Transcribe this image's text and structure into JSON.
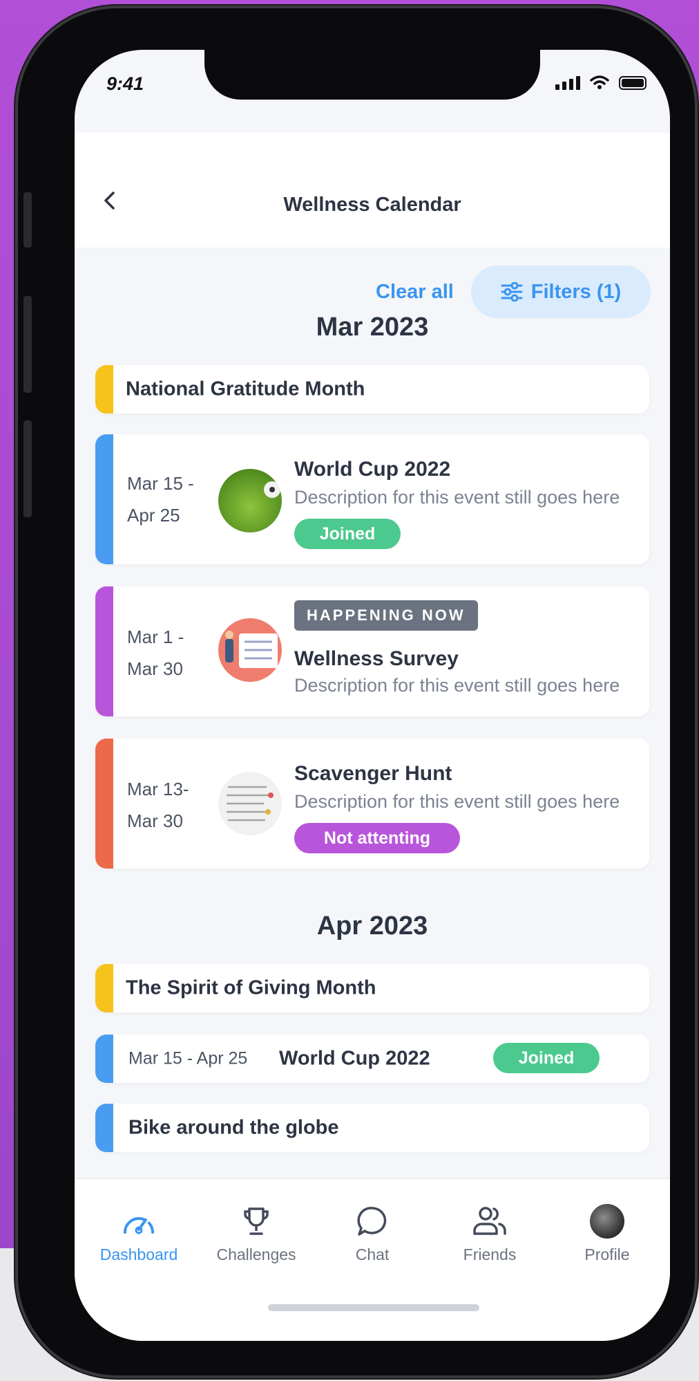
{
  "status": {
    "time": "9:41"
  },
  "header": {
    "title": "Wellness Calendar"
  },
  "filters": {
    "clear_label": "Clear all",
    "filters_label": "Filters (1)"
  },
  "months": [
    {
      "label": "Mar 2023",
      "observance": {
        "label": "National Gratitude Month",
        "color": "#f6c21c"
      },
      "events": [
        {
          "date_start": "Mar 15 -",
          "date_end": "Apr 25",
          "title": "World Cup 2022",
          "description": "Description for this event still goes here",
          "status": "Joined",
          "color": "#4a9cf2"
        },
        {
          "date_start": "Mar 1 -",
          "date_end": "Mar 30",
          "title": "Wellness Survey",
          "description": "Description for this event still goes here",
          "badge": "HAPPENING NOW",
          "color": "#b856db"
        },
        {
          "date_start": "Mar 13-",
          "date_end": "Mar 30",
          "title": "Scavenger Hunt",
          "description": "Description for this event still goes here",
          "status": "Not attenting",
          "color": "#ec6a4a"
        }
      ]
    },
    {
      "label": "Apr 2023",
      "observance": {
        "label": "The Spirit of Giving Month",
        "color": "#f6c21c"
      },
      "compact_events": [
        {
          "date": "Mar 15 - Apr 25",
          "title": "World Cup 2022",
          "status": "Joined",
          "color": "#4a9cf2"
        },
        {
          "title": "Bike around the globe",
          "color": "#4a9cf2"
        }
      ]
    }
  ],
  "colors": {
    "accent": "#3a94f0",
    "joined": "#4cc98e",
    "not_attending": "#b856db"
  },
  "tabs": [
    {
      "label": "Dashboard",
      "icon": "speedometer-icon",
      "active": true
    },
    {
      "label": "Challenges",
      "icon": "trophy-icon"
    },
    {
      "label": "Chat",
      "icon": "chat-bubble-icon"
    },
    {
      "label": "Friends",
      "icon": "friends-icon"
    },
    {
      "label": "Profile",
      "icon": "avatar"
    }
  ]
}
